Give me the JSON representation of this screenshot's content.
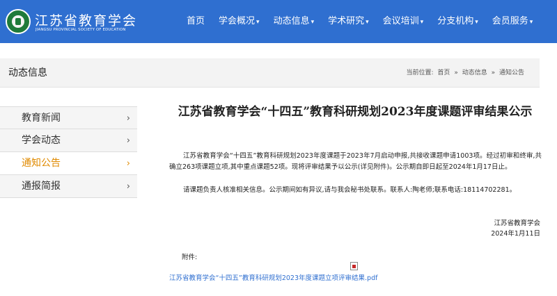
{
  "brand": {
    "name_cn": "江苏省教育学会",
    "name_en": "JIANGSU PROVINCIAL SOCIETY OF EDUCATION"
  },
  "nav": {
    "items": [
      {
        "label": "首页",
        "dropdown": false
      },
      {
        "label": "学会概况",
        "dropdown": true
      },
      {
        "label": "动态信息",
        "dropdown": true
      },
      {
        "label": "学术研究",
        "dropdown": true
      },
      {
        "label": "会议培训",
        "dropdown": true
      },
      {
        "label": "分支机构",
        "dropdown": true
      },
      {
        "label": "会员服务",
        "dropdown": true
      }
    ],
    "caret": "▾"
  },
  "section": {
    "title": "动态信息",
    "breadcrumb_prefix": "当前位置:",
    "breadcrumb": [
      "首页",
      "动态信息",
      "通知公告"
    ],
    "separator": "»"
  },
  "sidebar": {
    "items": [
      {
        "label": "教育新闻",
        "active": false
      },
      {
        "label": "学会动态",
        "active": false
      },
      {
        "label": "通知公告",
        "active": true
      },
      {
        "label": "通报简报",
        "active": false
      }
    ],
    "chevron": "›"
  },
  "article": {
    "title": "江苏省教育学会“十四五”教育科研规划2023年度课题评审结果公示",
    "paragraph1": "江苏省教育学会“十四五”教育科研规划2023年度课题于2023年7月启动申报,共接收课题申请1003项。经过初审和终审,共确立263项课题立项,其中重点课题52项。现将评审结果予以公示(详见附件)。公示期自即日起至2024年1月17日止。",
    "paragraph2": "请课题负责人核准相关信息。公示期间如有异议,请与我会秘书处联系。联系人:陶老师;联系电话:18114702281。",
    "signature_org": "江苏省教育学会",
    "signature_date": "2024年1月11日",
    "attachment_label": "附件:",
    "attachment_link": "江苏省教育学会“十四五”教育科研规划2023年度课题立项评审结果.pdf"
  },
  "colors": {
    "header_bg": "#2f6fd0",
    "active_item": "#e08a00",
    "link": "#2f6fd0"
  }
}
